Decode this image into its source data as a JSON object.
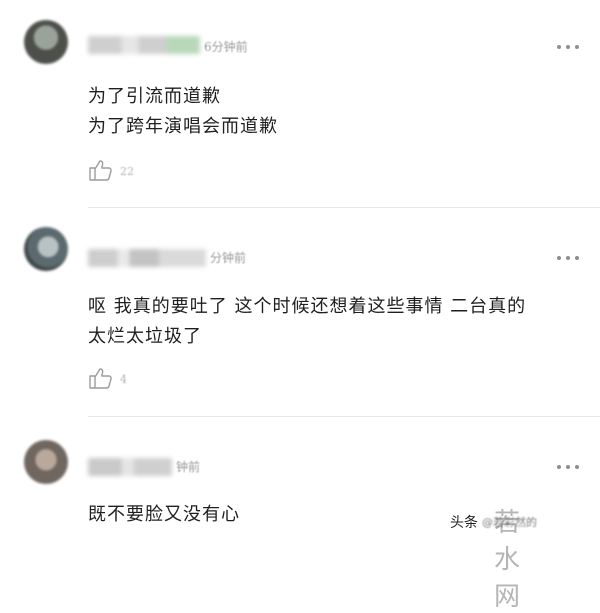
{
  "comments": [
    {
      "time": "6分钟前",
      "lines": [
        "为了引流而道歉",
        "为了跨年演唱会而道歉"
      ],
      "likes": "22"
    },
    {
      "time": "分钟前",
      "lines": [
        "呕 我真的要吐了 这个时候还想着这些事情 二台真的",
        "太烂太垃圾了"
      ],
      "likes": "4"
    },
    {
      "time": "钟前",
      "lines": [
        "既不要脸又没有心"
      ],
      "likes": ""
    }
  ],
  "icons": {
    "more": "more-dots-icon",
    "like": "thumbs-up-icon"
  },
  "watermark": {
    "label": "头条",
    "source": "@若彩然的",
    "site": "若水网"
  },
  "colors": {
    "muted": "#9a9a9a",
    "text": "#1f1f1f",
    "divider": "#e8e8e8"
  }
}
